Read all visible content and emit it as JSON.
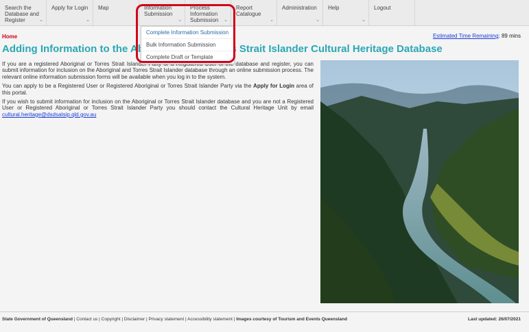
{
  "nav": [
    {
      "label": "Search the Database and Register"
    },
    {
      "label": "Apply for Login"
    },
    {
      "label": "Map"
    },
    {
      "label": "Information Submission"
    },
    {
      "label": "Process Information Submission"
    },
    {
      "label": "Report Catalogue"
    },
    {
      "label": "Administration"
    },
    {
      "label": "Help"
    },
    {
      "label": "Logout"
    }
  ],
  "dropdown": [
    {
      "label": "Complete Information Submission"
    },
    {
      "label": "Bulk Information Submission"
    },
    {
      "label": "Complete Draft or Template"
    }
  ],
  "breadcrumb": "Home",
  "estimated": {
    "link": "Estimated Time Remaining",
    "value": ": 89 mins"
  },
  "title": "Adding Information to the Aboriginal and Torres Strait Islander Cultural Heritage Database",
  "paragraphs": {
    "p1": "If you are a registered Aboriginal or Torres Strait Islander Party or a Registered User of the database and register, you can submit information for inclusion on the Aboriginal and Torres Strait Islander database through an online submission process. The relevant online information submission forms will be available when you log in to the system.",
    "p2_pre": "You can apply to be a Registered User or Registered Aboriginal or Torres Strait Islander Party via the ",
    "p2_bold": "Apply for Login",
    "p2_post": " area of this portal.",
    "p3_pre": "If you wish to submit information for inclusion on the Aboriginal or Torres Strait Islander database and you are not a Registered User or Registered Aboriginal or Torres Strait Islander Party you should contact the Cultural Heritage Unit by email ",
    "p3_email": "cultural.heritage@dsdsatsip.qld.gov.au"
  },
  "footer": {
    "org": "State Government of Queensland",
    "links": [
      "Contact us",
      "Copyright",
      "Disclaimer",
      "Privacy statement",
      "Accessibility statement"
    ],
    "images": "Images courtesy of Tourism and Events Queensland",
    "updated": "Last updated: 26/07/2021"
  },
  "colors": {
    "accent": "#2aa7b3",
    "highlight": "#d0021b",
    "link": "#1a3bd6"
  }
}
